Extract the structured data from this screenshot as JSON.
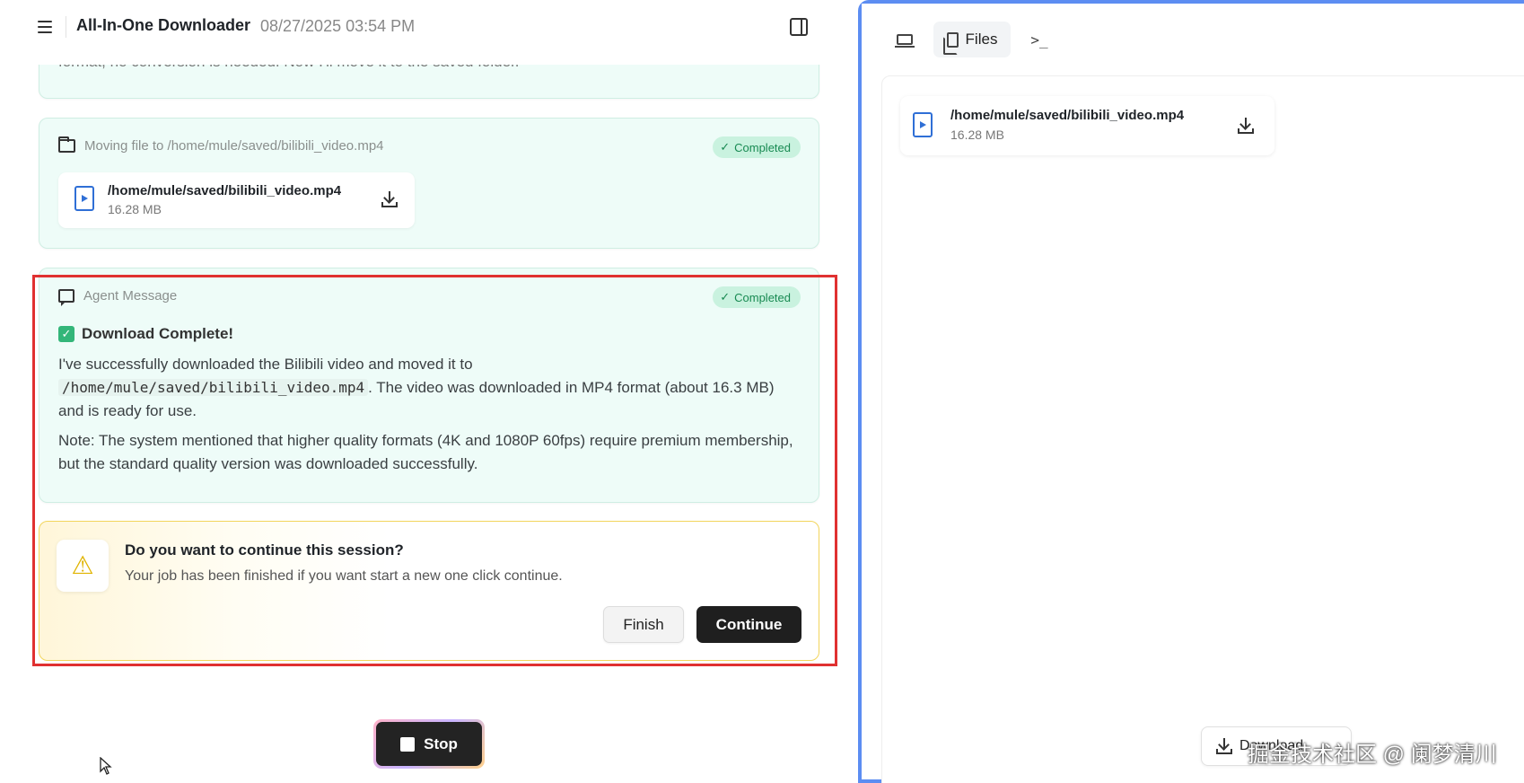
{
  "header": {
    "app_title": "All-In-One Downloader",
    "timestamp": "08/27/2025 03:54 PM"
  },
  "cards": {
    "top_cut_text": "format, no conversion is needed. Now I'll move it to the saved folder.",
    "move": {
      "label": "Moving file to /home/mule/saved/bilibili_video.mp4",
      "status": "Completed",
      "file": {
        "name": "/home/mule/saved/bilibili_video.mp4",
        "size": "16.28 MB"
      }
    },
    "agent": {
      "label": "Agent Message",
      "status": "Completed",
      "title": "Download Complete!",
      "p1_before": "I've successfully downloaded the Bilibili video and moved it to",
      "p1_code": "/home/mule/saved/bilibili_video.mp4",
      "p1_after": ". The video was downloaded in MP4 format (about 16.3 MB) and is ready for use.",
      "p2": "Note: The system mentioned that higher quality formats (4K and 1080P 60fps) require premium membership, but the standard quality version was downloaded successfully."
    }
  },
  "confirm": {
    "title": "Do you want to continue this session?",
    "subtitle": "Your job has been finished if you want start a new one click continue.",
    "finish_label": "Finish",
    "continue_label": "Continue"
  },
  "stop_label": "Stop",
  "right_panel": {
    "tab_files_label": "Files",
    "tab_terminal_glyph": ">_",
    "file": {
      "name": "/home/mule/saved/bilibili_video.mp4",
      "size": "16.28 MB"
    },
    "download_all_label": "Download"
  },
  "watermark": "掘金技术社区 @ 阑梦清川",
  "colors": {
    "accent_blue": "#5c8df2",
    "success_green": "#188a52",
    "card_bg": "#eefcf8",
    "warn_yellow": "#e0b400",
    "highlight_red": "#e03131"
  }
}
